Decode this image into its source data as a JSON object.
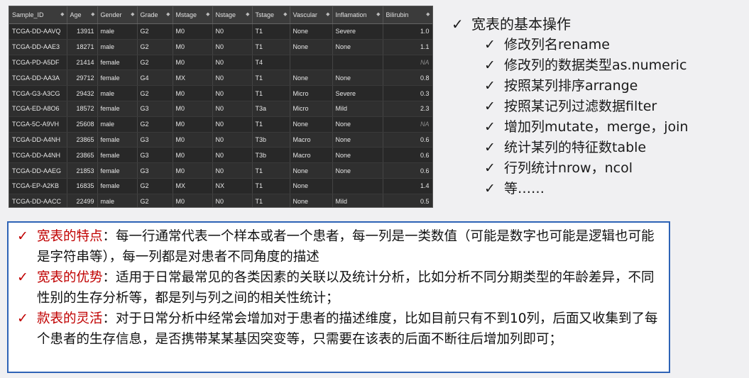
{
  "table": {
    "columns": [
      "Sample_ID",
      "Age",
      "Gender",
      "Grade",
      "Mstage",
      "Nstage",
      "Tstage",
      "Vascular",
      "Inflamation",
      "Bilirubin"
    ],
    "rows": [
      [
        "TCGA-DD-AAVQ",
        "13911",
        "male",
        "G2",
        "M0",
        "N0",
        "T1",
        "None",
        "Severe",
        "1.0"
      ],
      [
        "TCGA-DD-AAE3",
        "18271",
        "male",
        "G2",
        "M0",
        "N0",
        "T1",
        "None",
        "None",
        "1.1"
      ],
      [
        "TCGA-PD-A5DF",
        "21414",
        "female",
        "G2",
        "M0",
        "N0",
        "T4",
        "",
        "",
        "NA"
      ],
      [
        "TCGA-DD-AA3A",
        "29712",
        "female",
        "G4",
        "MX",
        "N0",
        "T1",
        "None",
        "None",
        "0.8"
      ],
      [
        "TCGA-G3-A3CG",
        "29432",
        "male",
        "G2",
        "M0",
        "N0",
        "T1",
        "Micro",
        "Severe",
        "0.3"
      ],
      [
        "TCGA-ED-A8O6",
        "18572",
        "female",
        "G3",
        "M0",
        "N0",
        "T3a",
        "Micro",
        "Mild",
        "2.3"
      ],
      [
        "TCGA-5C-A9VH",
        "25608",
        "male",
        "G2",
        "M0",
        "N0",
        "T1",
        "None",
        "None",
        "NA"
      ],
      [
        "TCGA-DD-A4NH",
        "23865",
        "female",
        "G3",
        "M0",
        "N0",
        "T3b",
        "Macro",
        "None",
        "0.6"
      ],
      [
        "TCGA-DD-A4NH",
        "23865",
        "female",
        "G3",
        "M0",
        "N0",
        "T3b",
        "Macro",
        "None",
        "0.6"
      ],
      [
        "TCGA-DD-AAEG",
        "21853",
        "female",
        "G3",
        "M0",
        "N0",
        "T1",
        "None",
        "None",
        "0.6"
      ],
      [
        "TCGA-EP-A2KB",
        "16835",
        "female",
        "G2",
        "MX",
        "NX",
        "T1",
        "None",
        "",
        "1.4"
      ],
      [
        "TCGA-DD-AACC",
        "22499",
        "male",
        "G2",
        "M0",
        "N0",
        "T1",
        "None",
        "Mild",
        "0.5"
      ]
    ]
  },
  "ops": {
    "check": "✓",
    "title": "宽表的基本操作",
    "items": [
      "修改列名rename",
      "修改列的数据类型as.numeric",
      "按照某列排序arrange",
      "按照某记列过滤数据filter",
      "增加列mutate，merge，join",
      "统计某列的特征数table",
      "行列统计nrow，ncol",
      "等……"
    ]
  },
  "box": {
    "check": "✓",
    "items": [
      {
        "term": "宽表的特点",
        "text": "：每一行通常代表一个样本或者一个患者，每一列是一类数值（可能是数字也可能是逻辑也可能是字符串等），每一列都是对患者不同角度的描述"
      },
      {
        "term": "宽表的优势",
        "text": "：适用于日常最常见的各类因素的关联以及统计分析，比如分析不同分期类型的年龄差异，不同性别的生存分析等，都是列与列之间的相关性统计；"
      },
      {
        "term": "款表的灵活",
        "text": "：对于日常分析中经常会增加对于患者的描述维度，比如目前只有不到10列，后面又收集到了每个患者的生存信息，是否携带某某基因突变等，只需要在该表的后面不断往后增加列即可；"
      }
    ]
  },
  "colors": {
    "accent_red": "#c00000",
    "box_border": "#2e63b6"
  }
}
